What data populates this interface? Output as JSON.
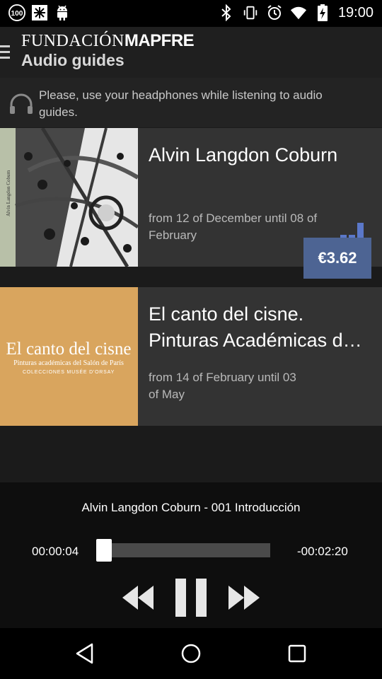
{
  "status_bar": {
    "time": "19:00",
    "badge": "100",
    "left_icons": [
      "badge-100-icon",
      "snowflake-app-icon",
      "android-icon"
    ],
    "right_icons": [
      "bluetooth-icon",
      "vibrate-icon",
      "alarm-icon",
      "wifi-icon",
      "battery-charging-icon"
    ]
  },
  "header": {
    "brand_part1": "FUNDACIÓN",
    "brand_part2": "MAPFRE",
    "title": "Audio guides"
  },
  "notice": {
    "text": "Please, use your headphones while listening to audio guides."
  },
  "guides": [
    {
      "title": "Alvin Langdon Coburn",
      "dates": "from 12 of December until 08 of February",
      "cover_spine_text": "Alvin Langdon Coburn",
      "status_icon": "signal-bars-icon"
    },
    {
      "title": "El canto del cisne. Pinturas Académicas d…",
      "dates": "from 14 of February until 03 of May",
      "price": "€3.62",
      "cover_title": "El canto del cisne",
      "cover_subtitle": "Pinturas académicas del Salón de París",
      "cover_caption": "COLECCIONES MUSÉE D'ORSAY"
    }
  ],
  "player": {
    "track": "Alvin Langdon Coburn - 001 Introducción",
    "elapsed": "00:00:04",
    "remaining": "-00:02:20",
    "progress": 0.03
  },
  "colors": {
    "accent_price": "#4d6493",
    "signal_blue": "#5b78c9",
    "cover2_bg": "#d9a55e"
  }
}
